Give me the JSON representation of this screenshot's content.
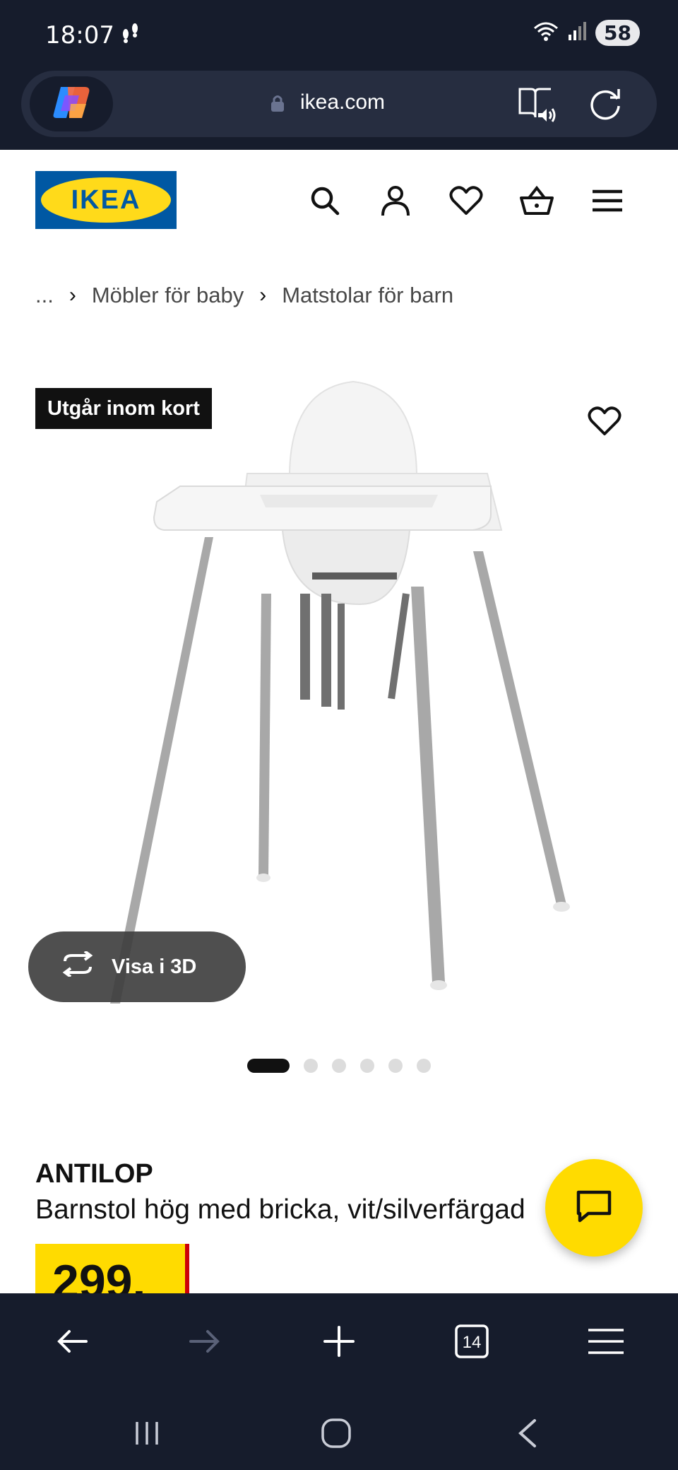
{
  "status_bar": {
    "time": "18:07",
    "battery": "58"
  },
  "browser": {
    "url": "ikea.com",
    "tab_count": "14"
  },
  "site": {
    "logo_text": "IKEA"
  },
  "breadcrumb": {
    "ellipsis": "...",
    "items": [
      "Möbler för baby",
      "Matstolar för barn"
    ]
  },
  "product": {
    "badge": "Utgår inom kort",
    "view_3d": "Visa i 3D",
    "name": "ANTILOP",
    "description": "Barnstol hög med bricka, vit/silverfärgad",
    "price": "299.",
    "image_count": 6,
    "active_image": 1
  },
  "colors": {
    "ikea_blue": "#0058a3",
    "ikea_yellow": "#ffdb00",
    "browser_dark": "#161c2c"
  }
}
